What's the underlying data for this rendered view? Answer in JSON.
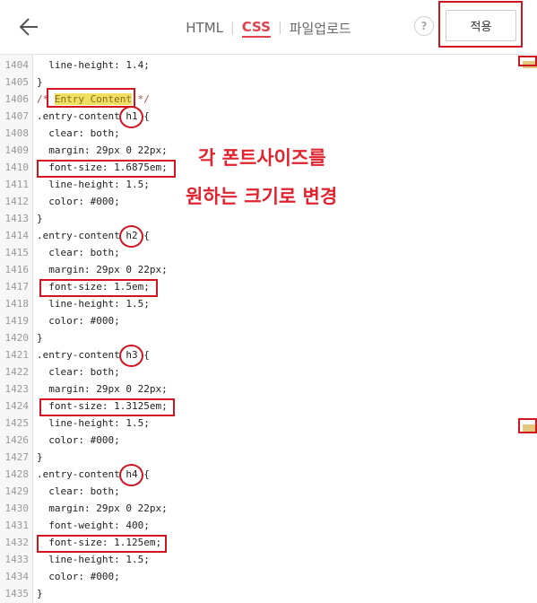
{
  "header": {
    "back_icon": "arrow-left-icon",
    "tabs": [
      {
        "label": "HTML",
        "active": false
      },
      {
        "label": "CSS",
        "active": true
      },
      {
        "label": "파일업로드",
        "active": false
      }
    ],
    "help_label": "?",
    "apply_label": "적용"
  },
  "annotation": {
    "line1": "각 폰트사이즈를",
    "line2": "원하는 크기로 변경"
  },
  "colors": {
    "accent": "#e0414d",
    "annotation": "#d01520",
    "highlight": "#f0e060"
  },
  "code_lines": [
    {
      "n": "1404",
      "text": "  line-height: 1.4;"
    },
    {
      "n": "1405",
      "text": "}"
    },
    {
      "n": "1406",
      "text": "/* Entry Content */"
    },
    {
      "n": "1407",
      "text": ".entry-content h1 {"
    },
    {
      "n": "1408",
      "text": "  clear: both;"
    },
    {
      "n": "1409",
      "text": "  margin: 29px 0 22px;"
    },
    {
      "n": "1410",
      "text": "  font-size: 1.6875em;"
    },
    {
      "n": "1411",
      "text": "  line-height: 1.5;"
    },
    {
      "n": "1412",
      "text": "  color: #000;"
    },
    {
      "n": "1413",
      "text": "}"
    },
    {
      "n": "1414",
      "text": ".entry-content h2 {"
    },
    {
      "n": "1415",
      "text": "  clear: both;"
    },
    {
      "n": "1416",
      "text": "  margin: 29px 0 22px;"
    },
    {
      "n": "1417",
      "text": "  font-size: 1.5em;"
    },
    {
      "n": "1418",
      "text": "  line-height: 1.5;"
    },
    {
      "n": "1419",
      "text": "  color: #000;"
    },
    {
      "n": "1420",
      "text": "}"
    },
    {
      "n": "1421",
      "text": ".entry-content h3 {"
    },
    {
      "n": "1422",
      "text": "  clear: both;"
    },
    {
      "n": "1423",
      "text": "  margin: 29px 0 22px;"
    },
    {
      "n": "1424",
      "text": "  font-size: 1.3125em;"
    },
    {
      "n": "1425",
      "text": "  line-height: 1.5;"
    },
    {
      "n": "1426",
      "text": "  color: #000;"
    },
    {
      "n": "1427",
      "text": "}"
    },
    {
      "n": "1428",
      "text": ".entry-content h4 {"
    },
    {
      "n": "1429",
      "text": "  clear: both;"
    },
    {
      "n": "1430",
      "text": "  margin: 29px 0 22px;"
    },
    {
      "n": "1431",
      "text": "  font-weight: 400;"
    },
    {
      "n": "1432",
      "text": "  font-size: 1.125em;"
    },
    {
      "n": "1433",
      "text": "  line-height: 1.5;"
    },
    {
      "n": "1434",
      "text": "  color: #000;"
    },
    {
      "n": "1435",
      "text": "}"
    }
  ]
}
